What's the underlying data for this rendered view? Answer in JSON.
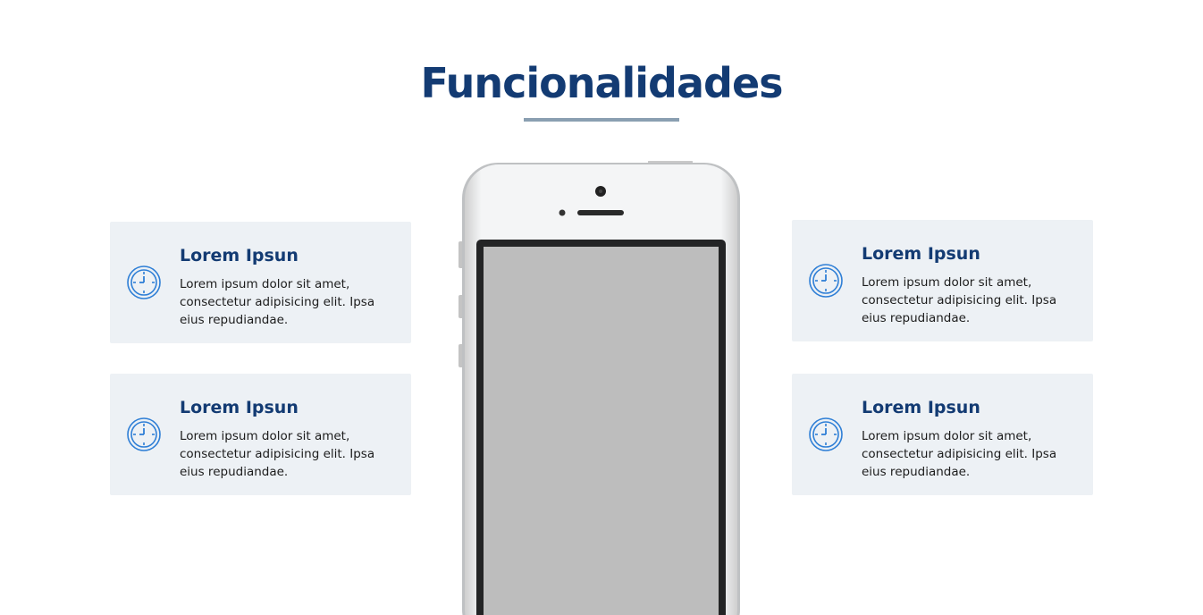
{
  "section": {
    "title": "Funcionalidades"
  },
  "features": [
    {
      "title": "Lorem Ipsun",
      "text": "Lorem ipsum dolor sit amet, consectetur adipisicing elit. Ipsa eius repudiandae.",
      "icon": "clock-icon"
    },
    {
      "title": "Lorem Ipsun",
      "text": "Lorem ipsum dolor sit amet, consectetur adipisicing elit. Ipsa eius repudiandae.",
      "icon": "clock-icon"
    },
    {
      "title": "Lorem Ipsun",
      "text": "Lorem ipsum dolor sit amet, consectetur adipisicing elit. Ipsa eius repudiandae.",
      "icon": "clock-icon"
    },
    {
      "title": "Lorem Ipsun",
      "text": "Lorem ipsum dolor sit amet, consectetur adipisicing elit. Ipsa eius repudiandae.",
      "icon": "clock-icon"
    }
  ],
  "colors": {
    "title": "#133b73",
    "accent": "#2f7fd6",
    "card_background": "#edf1f5",
    "underline": "#8a9fb1",
    "screen": "#bdbdbd"
  }
}
